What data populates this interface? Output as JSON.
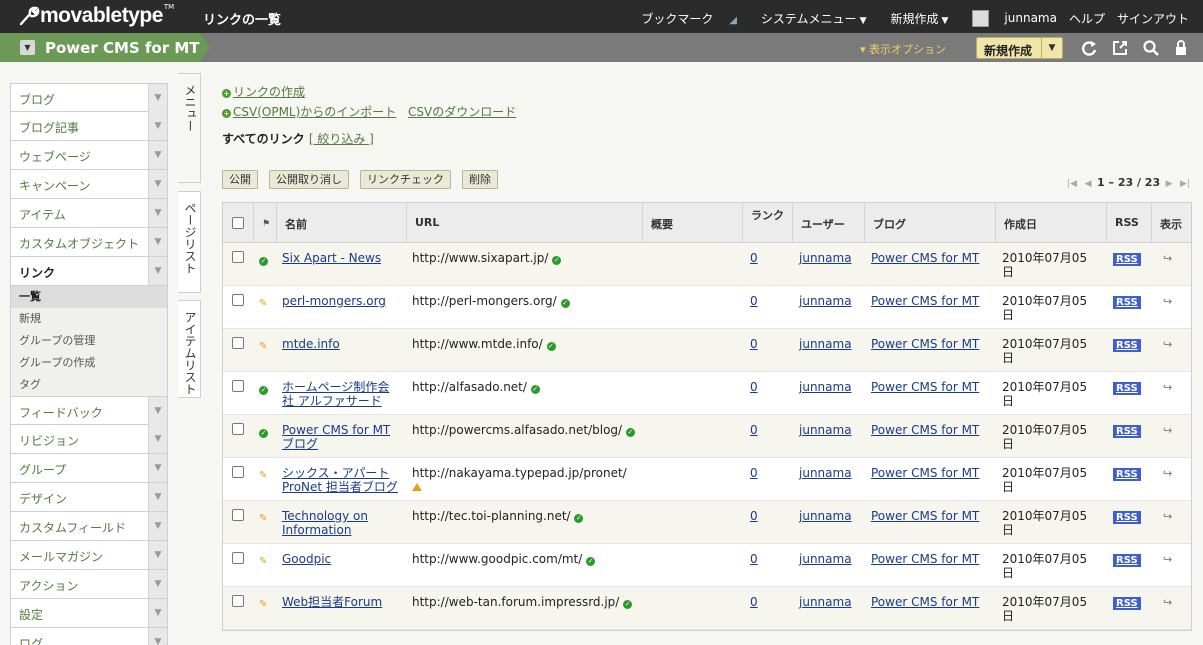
{
  "header": {
    "logo": "movabletype",
    "logo_tm": "TM",
    "page_title": "リンクの一覧",
    "nav": {
      "bookmark": "ブックマーク",
      "system_menu": "システムメニュー",
      "new_create": "新規作成",
      "username": "junnama",
      "help": "ヘルプ",
      "signout": "サインアウト"
    }
  },
  "blogbar": {
    "blog_name": "Power CMS for MT",
    "display_options": "▾ 表示オプション",
    "new_button": "新規作成"
  },
  "sidebar": {
    "items_top": [
      {
        "label": "ブログ"
      },
      {
        "label": "ブログ記事"
      },
      {
        "label": "ウェブページ"
      },
      {
        "label": "キャンペーン"
      },
      {
        "label": "アイテム"
      },
      {
        "label": "カスタムオブジェクト"
      }
    ],
    "active": {
      "label": "リンク"
    },
    "subitems": [
      "一覧",
      "新規",
      "グループの管理",
      "グループの作成",
      "タグ"
    ],
    "items_bottom": [
      {
        "label": "フィードバック"
      },
      {
        "label": "リビジョン"
      },
      {
        "label": "グループ"
      },
      {
        "label": "デザイン"
      },
      {
        "label": "カスタムフィールド"
      },
      {
        "label": "メールマガジン"
      },
      {
        "label": "アクション"
      },
      {
        "label": "設定"
      },
      {
        "label": "ログ"
      }
    ]
  },
  "vtabs": [
    "メニュー",
    "ページリスト",
    "アイテムリスト"
  ],
  "actions": {
    "create_link": "リンクの作成",
    "import_csv": "CSV(OPML)からのインポート",
    "download_csv": "CSVのダウンロード",
    "filter_label": "すべてのリンク",
    "filter_link": "[ 絞り込み ]"
  },
  "buttons": [
    "公開",
    "公開取り消し",
    "リンクチェック",
    "削除"
  ],
  "pager": {
    "range": "1 – 23 / 23"
  },
  "table": {
    "headers": [
      "名前",
      "URL",
      "概要",
      "ランク",
      "ユーザー",
      "ブログ",
      "作成日",
      "RSS",
      "表示"
    ],
    "rows": [
      {
        "status": "ok",
        "name": "Six Apart - News",
        "url": "http://www.sixapart.jp/",
        "url_status": "ok",
        "rank": "0",
        "user": "junnama",
        "blog": "Power CMS for MT",
        "date": "2010年07月05日",
        "rss": "RSS"
      },
      {
        "status": "draft",
        "name": "perl-mongers.org",
        "url": "http://perl-mongers.org/",
        "url_status": "ok",
        "rank": "0",
        "user": "junnama",
        "blog": "Power CMS for MT",
        "date": "2010年07月05日",
        "rss": "RSS"
      },
      {
        "status": "draft",
        "name": "mtde.info",
        "url": "http://www.mtde.info/",
        "url_status": "ok",
        "rank": "0",
        "user": "junnama",
        "blog": "Power CMS for MT",
        "date": "2010年07月05日",
        "rss": "RSS"
      },
      {
        "status": "ok",
        "name": "ホームページ制作会社 アルファサード",
        "url": "http://alfasado.net/",
        "url_status": "ok",
        "rank": "0",
        "user": "junnama",
        "blog": "Power CMS for MT",
        "date": "2010年07月05日",
        "rss": "RSS"
      },
      {
        "status": "ok",
        "name": "Power CMS for MT ブログ",
        "url": "http://powercms.alfasado.net/blog/",
        "url_status": "ok",
        "rank": "0",
        "user": "junnama",
        "blog": "Power CMS for MT",
        "date": "2010年07月05日",
        "rss": "RSS"
      },
      {
        "status": "draft",
        "name": "シックス・アパート ProNet 担当者ブログ",
        "url": "http://nakayama.typepad.jp/pronet/",
        "url_status": "warn",
        "rank": "0",
        "user": "junnama",
        "blog": "Power CMS for MT",
        "date": "2010年07月05日",
        "rss": "RSS"
      },
      {
        "status": "draft",
        "name": "Technology on Information",
        "url": "http://tec.toi-planning.net/",
        "url_status": "ok",
        "rank": "0",
        "user": "junnama",
        "blog": "Power CMS for MT",
        "date": "2010年07月05日",
        "rss": "RSS"
      },
      {
        "status": "draft",
        "name": "Goodpic",
        "url": "http://www.goodpic.com/mt/",
        "url_status": "ok",
        "rank": "0",
        "user": "junnama",
        "blog": "Power CMS for MT",
        "date": "2010年07月05日",
        "rss": "RSS"
      },
      {
        "status": "draft",
        "name": "Web担当者Forum",
        "url": "http://web-tan.forum.impressrd.jp/",
        "url_status": "ok",
        "rank": "0",
        "user": "junnama",
        "blog": "Power CMS for MT",
        "date": "2010年07月05日",
        "rss": "RSS"
      }
    ]
  },
  "colors": {
    "topbar": "#2b2b2b",
    "blogtab": "#6c9a56",
    "link_green": "#557a3e",
    "link_blue": "#1a3a8a",
    "rss_badge": "#3f5fcf"
  }
}
